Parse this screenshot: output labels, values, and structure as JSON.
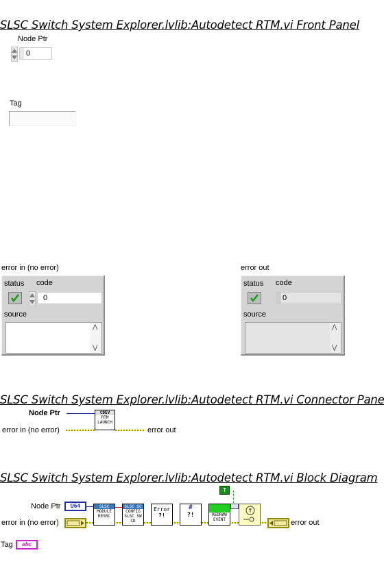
{
  "front_panel": {
    "title": "SLSC Switch System Explorer.lvlib:Autodetect RTM.vi Front Panel",
    "node_ptr": {
      "label": "Node Ptr",
      "value": "0"
    },
    "tag": {
      "label": "Tag",
      "value": ""
    },
    "error_in": {
      "label": "error in (no error)",
      "status_label": "status",
      "code_label": "code",
      "code_value": "0",
      "source_label": "source",
      "source_value": ""
    },
    "error_out": {
      "label": "error out",
      "status_label": "status",
      "code_label": "code",
      "code_value": "0",
      "source_label": "source",
      "source_value": ""
    }
  },
  "connector_pane": {
    "title": "SLSC Switch System Explorer.lvlib:Autodetect RTM.vi Connector Pane",
    "left_terms": [
      "Node Ptr",
      "error in (no error)"
    ],
    "right_terms": [
      "error out"
    ],
    "icon_text": [
      "CDEV",
      "RTM",
      "LAUNCH"
    ]
  },
  "block_diagram": {
    "title": "SLSC Switch System Explorer.lvlib:Autodetect RTM.vi Block Diagram",
    "node_ptr_label": "Node Ptr",
    "node_ptr_type": "U64",
    "error_in_label": "error in (no error)",
    "error_out_label": "error out",
    "tag_label": "Tag",
    "tag_type": "abc",
    "true_constant": "T",
    "subvis": [
      {
        "name": "slsc-module-resrc",
        "text": [
          "SLSC",
          "MODULE",
          "RESRC"
        ]
      },
      {
        "name": "config-slsc-sw-cd",
        "text": [
          "SLSC SC",
          "CONFIG",
          "SLSC SW",
          "CD"
        ]
      },
      {
        "name": "error-handler",
        "text": [
          "Error",
          "?!"
        ]
      },
      {
        "name": "format-into-string",
        "text": [
          "#",
          "?!"
        ]
      },
      {
        "name": "redraw-event",
        "text": [
          "REDRAW",
          "EVENT"
        ]
      }
    ]
  }
}
